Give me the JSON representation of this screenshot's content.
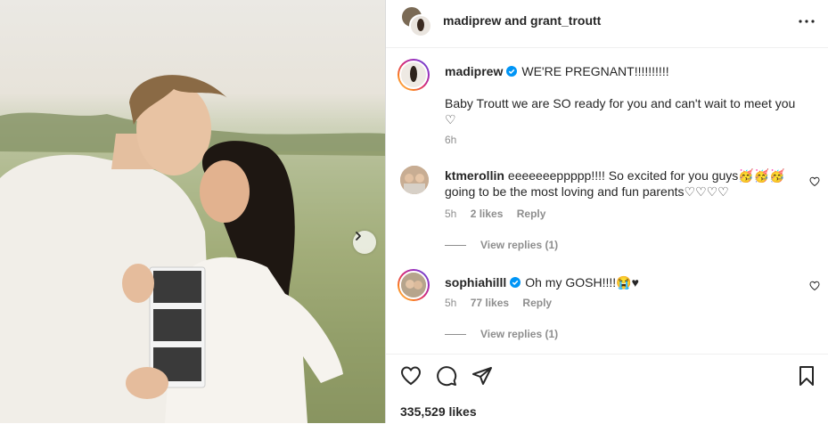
{
  "header": {
    "title": "madiprew and grant_troutt"
  },
  "caption": {
    "username": "madiprew",
    "line1": "WE'RE PREGNANT!!!!!!!!!!",
    "line2": "Baby Troutt we are SO ready for you and can't wait to meet you",
    "line3": "♡ ",
    "time": "6h"
  },
  "comments": [
    {
      "username": "ktmerollin",
      "text1": "eeeeeeeppppp!!!! So excited for you guys🥳🥳🥳",
      "text2": "going to be the most loving and fun parents♡♡♡♡",
      "time": "5h",
      "likes": "2 likes",
      "reply": "Reply",
      "view_replies": "View replies (1)"
    },
    {
      "username": "sophiahilll",
      "text1": "Oh my GOSH!!!!😭♥",
      "time": "5h",
      "likes": "77 likes",
      "reply": "Reply",
      "view_replies": "View replies (1)"
    }
  ],
  "footer": {
    "likes": "335,529 likes"
  },
  "icons": {
    "verified_color": "#0095f6",
    "more": "more-options-icon",
    "carousel": "chevron-right-icon",
    "like": "heart-icon",
    "comment": "comment-icon",
    "share": "share-icon",
    "save": "bookmark-icon"
  }
}
